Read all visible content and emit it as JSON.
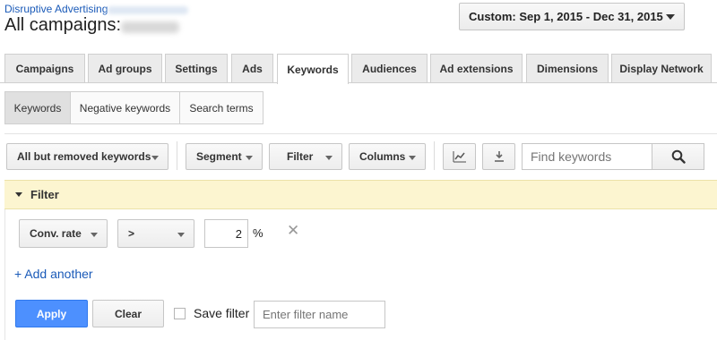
{
  "header": {
    "account": "Disruptive Advertising",
    "title": "All campaigns:"
  },
  "date_range": {
    "label": "Custom: Sep 1, 2015 - Dec 31, 2015"
  },
  "tabs": [
    {
      "label": "Campaigns"
    },
    {
      "label": "Ad groups"
    },
    {
      "label": "Settings"
    },
    {
      "label": "Ads"
    },
    {
      "label": "Keywords",
      "active": true
    },
    {
      "label": "Audiences"
    },
    {
      "label": "Ad extensions"
    },
    {
      "label": "Dimensions"
    },
    {
      "label": "Display Network"
    }
  ],
  "subtabs": [
    {
      "label": "Keywords",
      "active": true
    },
    {
      "label": "Negative keywords"
    },
    {
      "label": "Search terms"
    }
  ],
  "toolbar": {
    "view_filter": "All but removed keywords",
    "segment": "Segment",
    "filter": "Filter",
    "columns": "Columns",
    "chart_icon": "line-chart-icon",
    "download_icon": "download-icon",
    "search_placeholder": "Find keywords",
    "search_icon": "magnifier-icon"
  },
  "filter": {
    "heading": "Filter",
    "metric": "Conv. rate",
    "operator": ">",
    "value": "2",
    "unit": "%",
    "remove_icon": "x-icon",
    "add_another": "+ Add another",
    "apply": "Apply",
    "clear": "Clear",
    "save_label": "Save filter",
    "name_placeholder": "Enter filter name"
  },
  "colors": {
    "accent_blue": "#4d90fe",
    "link_blue": "#1a5ab8",
    "filter_bg": "#fcf5d0"
  }
}
